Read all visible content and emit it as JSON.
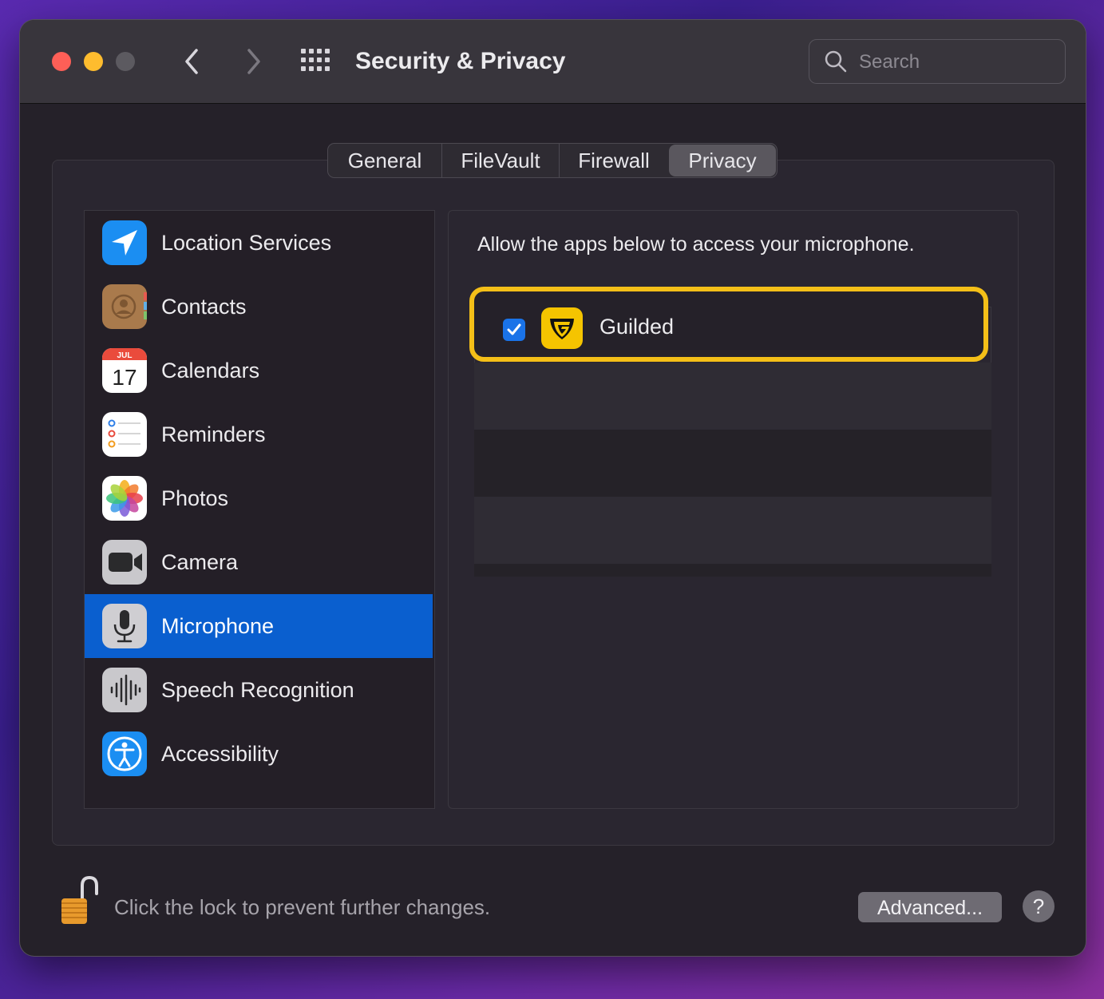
{
  "window": {
    "title": "Security & Privacy"
  },
  "search": {
    "placeholder": "Search",
    "value": ""
  },
  "tabs": [
    {
      "label": "General",
      "active": false
    },
    {
      "label": "FileVault",
      "active": false
    },
    {
      "label": "Firewall",
      "active": false
    },
    {
      "label": "Privacy",
      "active": true
    }
  ],
  "sidebar": {
    "items": [
      {
        "label": "Location Services",
        "icon": "location-arrow-icon",
        "selected": false
      },
      {
        "label": "Contacts",
        "icon": "contacts-icon",
        "selected": false
      },
      {
        "label": "Calendars",
        "icon": "calendar-icon",
        "selected": false,
        "calendar_month": "JUL",
        "calendar_day": "17"
      },
      {
        "label": "Reminders",
        "icon": "reminders-icon",
        "selected": false
      },
      {
        "label": "Photos",
        "icon": "photos-icon",
        "selected": false
      },
      {
        "label": "Camera",
        "icon": "camera-icon",
        "selected": false
      },
      {
        "label": "Microphone",
        "icon": "microphone-icon",
        "selected": true
      },
      {
        "label": "Speech Recognition",
        "icon": "speech-waveform-icon",
        "selected": false
      },
      {
        "label": "Accessibility",
        "icon": "accessibility-icon",
        "selected": false
      }
    ]
  },
  "main": {
    "prompt": "Allow the apps below to access your microphone.",
    "apps": [
      {
        "name": "Guilded",
        "checked": true,
        "icon": "guilded-icon"
      }
    ]
  },
  "footer": {
    "lock_text": "Click the lock to prevent further changes.",
    "advanced_label": "Advanced...",
    "help_label": "?"
  },
  "colors": {
    "selection": "#0a5fcf",
    "highlight_border": "#f4bf18",
    "checkbox": "#1a73e8"
  }
}
